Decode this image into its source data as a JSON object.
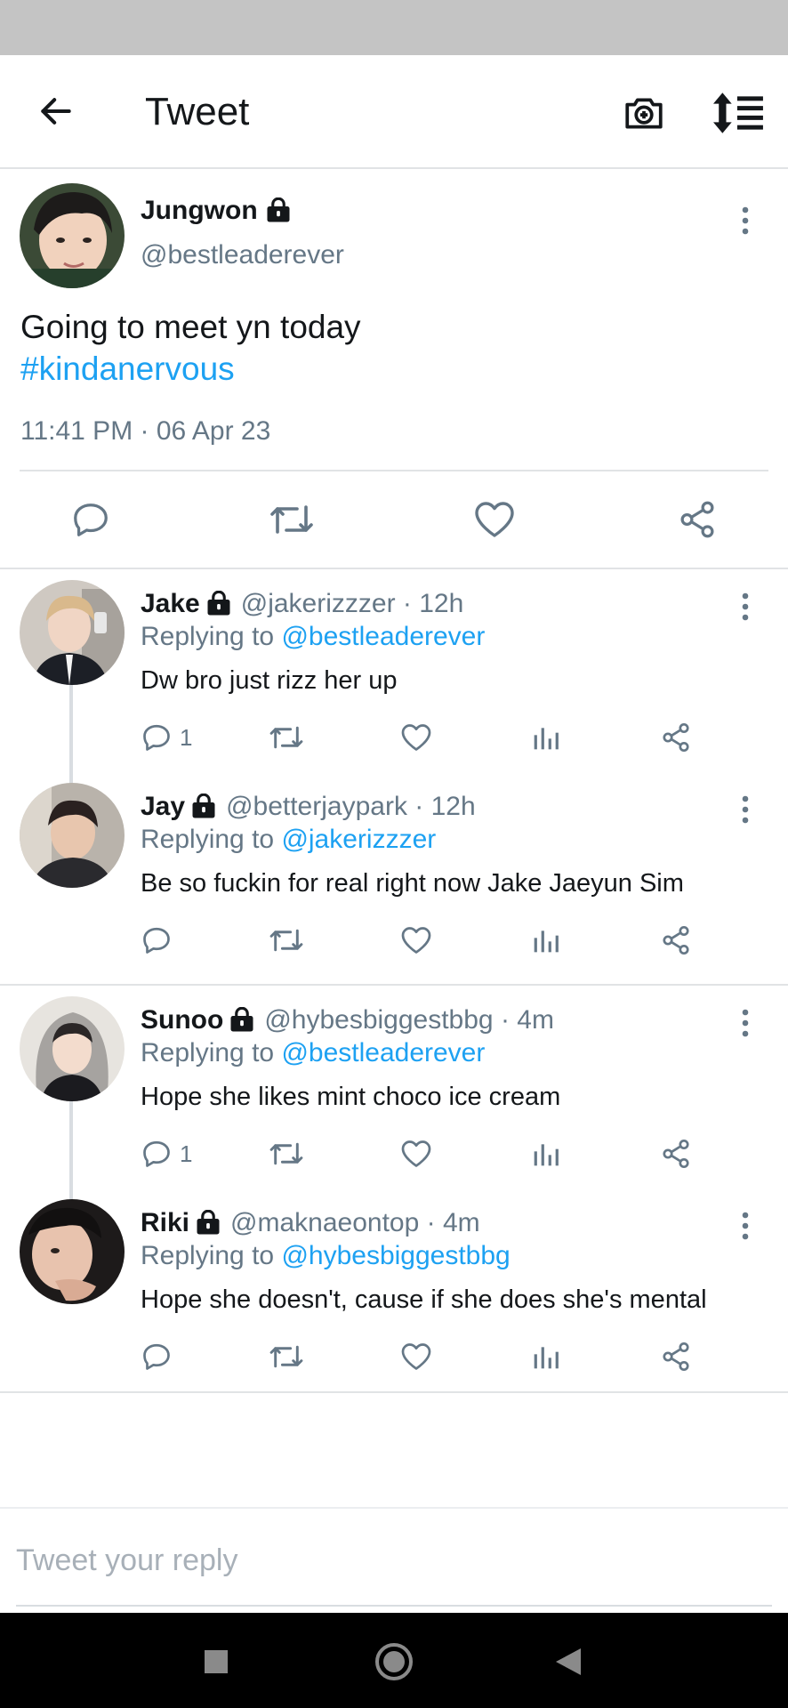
{
  "topbar": {
    "title": "Tweet"
  },
  "main_tweet": {
    "name": "Jungwon",
    "handle": "@bestleaderever",
    "text": "Going to meet yn today",
    "hashtag": "#kindanervous",
    "timestamp": "11:41 PM · 06 Apr 23"
  },
  "replies": [
    {
      "name": "Jake",
      "meta": "@jakerizzzer · 12h",
      "replying_prefix": "Replying to ",
      "replying_to": "@bestleaderever",
      "text": "Dw bro just rizz her up",
      "reply_count": "1"
    },
    {
      "name": "Jay",
      "meta": "@betterjaypark · 12h",
      "replying_prefix": "Replying to ",
      "replying_to": "@jakerizzzer",
      "text": "Be so fuckin for real right now Jake Jaeyun Sim",
      "reply_count": ""
    },
    {
      "name": "Sunoo",
      "meta": "@hybesbiggestbbg · 4m",
      "replying_prefix": "Replying to ",
      "replying_to": "@bestleaderever",
      "text": "Hope she likes mint choco ice cream",
      "reply_count": "1"
    },
    {
      "name": "Riki",
      "meta": "@maknaeontop · 4m",
      "replying_prefix": "Replying to ",
      "replying_to": "@hybesbiggestbbg",
      "text": "Hope she doesn't, cause if she does she's mental",
      "reply_count": ""
    }
  ],
  "compose": {
    "placeholder": "Tweet your reply"
  },
  "colors": {
    "accent": "#1da1f2",
    "muted": "#657786",
    "status_bar": "#c4c4c4"
  },
  "icons": {
    "back": "arrow-left-icon",
    "camera": "camera-plus-icon",
    "sort": "sort-list-icon",
    "reply": "comment-icon",
    "retweet": "retweet-icon",
    "like": "heart-icon",
    "analytics": "bar-chart-icon",
    "share": "share-icon",
    "more": "more-vertical-icon",
    "lock": "lock-icon"
  }
}
